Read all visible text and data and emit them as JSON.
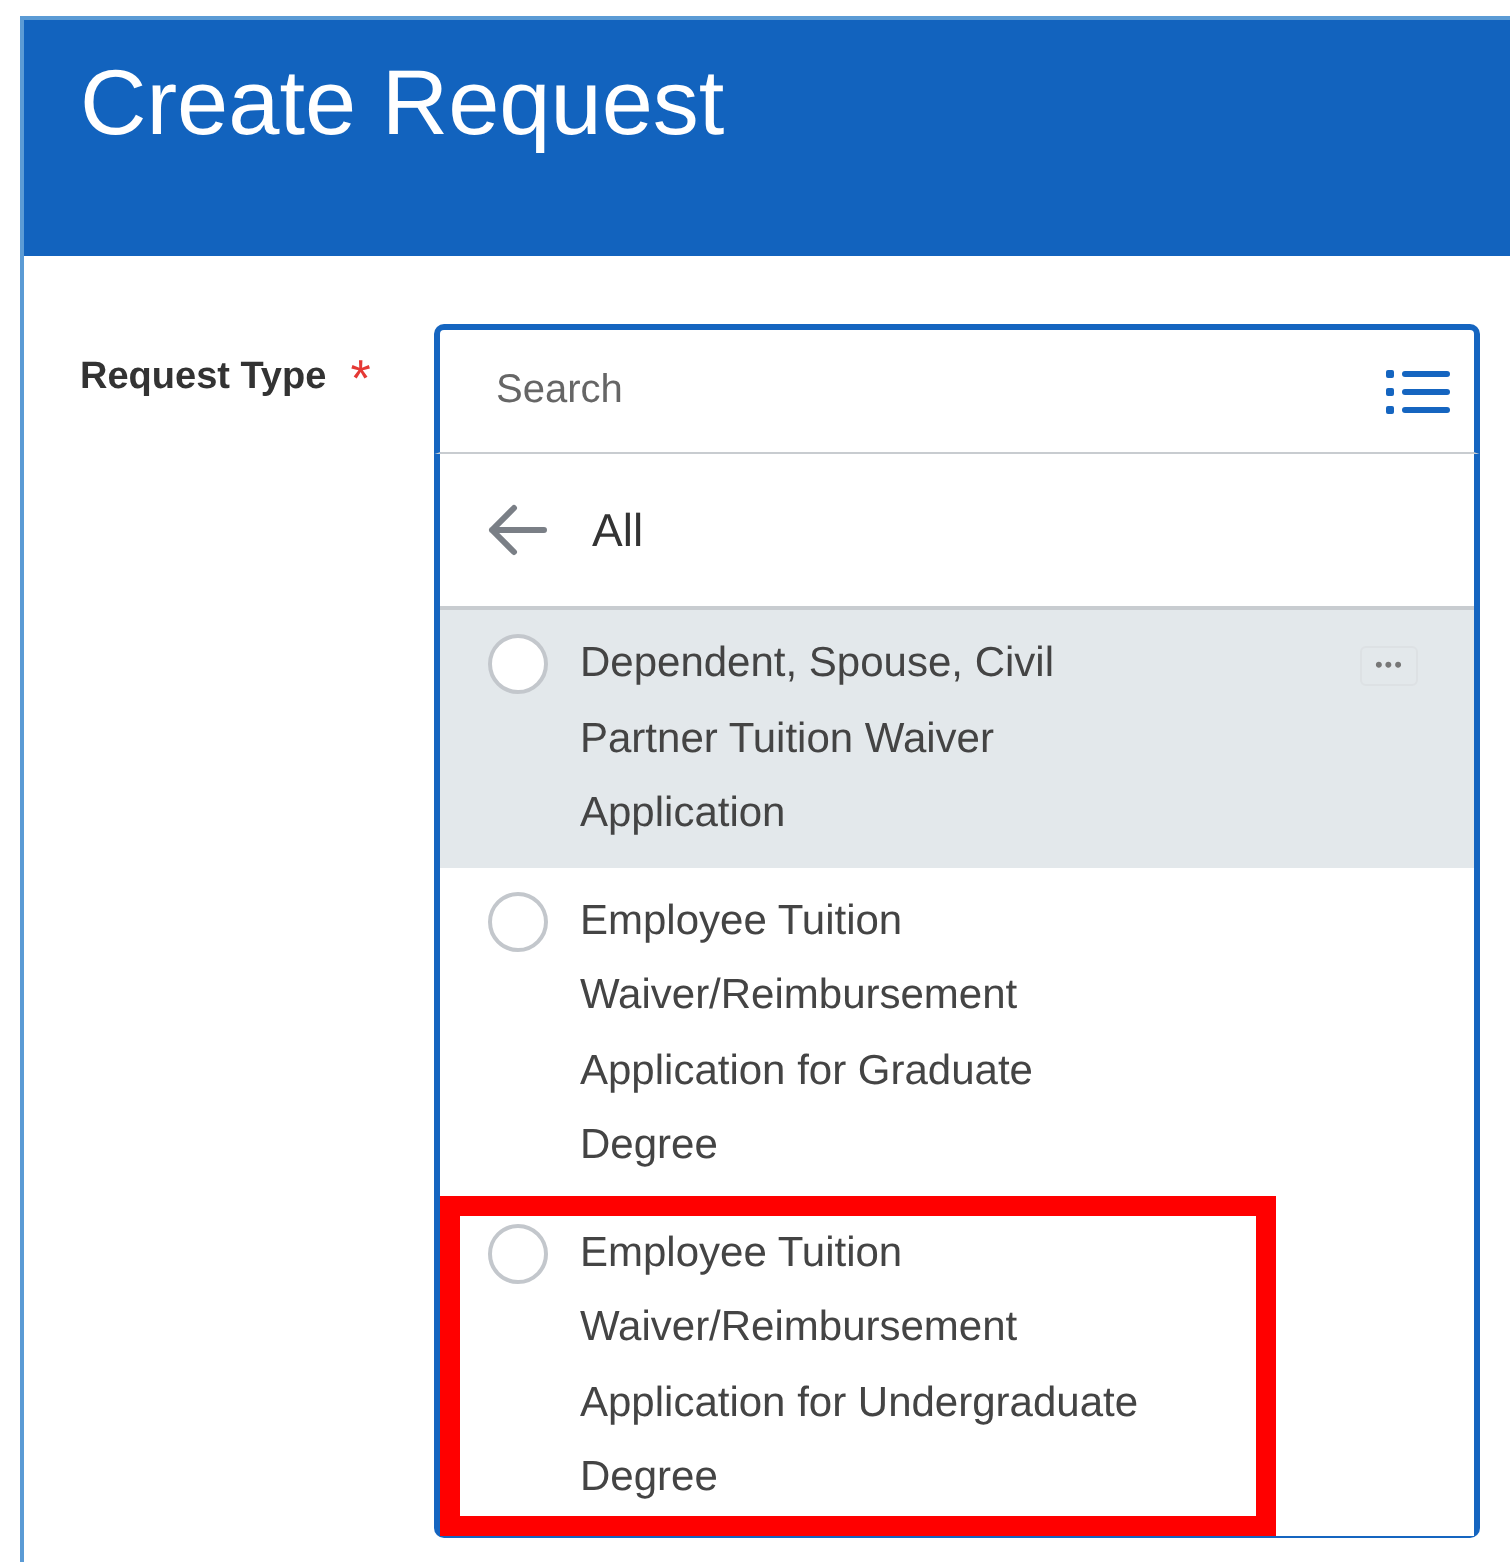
{
  "header": {
    "title": "Create Request"
  },
  "field": {
    "label": "Request Type",
    "required": true,
    "required_mark": "*",
    "search": {
      "placeholder": "Search"
    }
  },
  "dropdown": {
    "back_label": "All",
    "items": [
      {
        "label": "Dependent, Spouse, Civil Partner Tuition Waiver Application",
        "selected": false,
        "hovered": true,
        "highlighted": false,
        "more": "•••"
      },
      {
        "label": "Employee Tuition Waiver/Reimbursement Application for Graduate Degree",
        "selected": false,
        "hovered": false,
        "highlighted": false
      },
      {
        "label": "Employee Tuition Waiver/Reimbursement Application for Undergraduate Degree",
        "selected": false,
        "hovered": false,
        "highlighted": true
      }
    ]
  }
}
